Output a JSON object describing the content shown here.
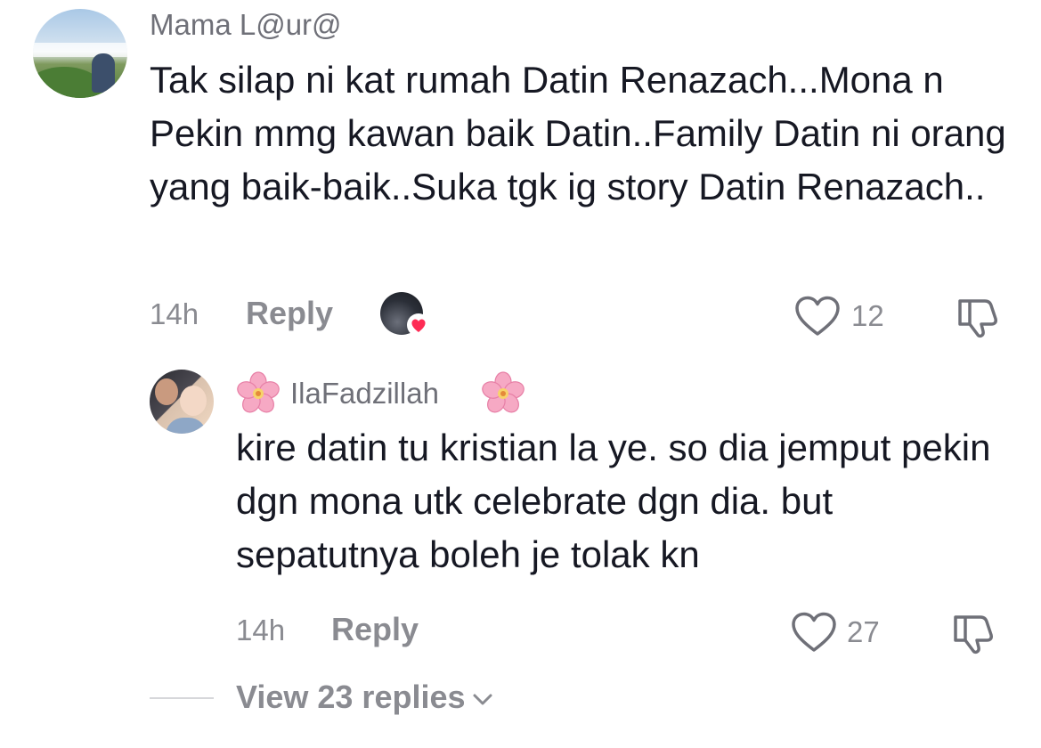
{
  "comments": [
    {
      "username": "Mama L@ur@",
      "text": "Tak silap ni kat rumah Datin Renazach...Mona n Pekin mmg kawan baik Datin..Family Datin ni orang yang baik-baik..Suka tgk ig story Datin Renazach..",
      "time": "14h",
      "reply_label": "Reply",
      "likes": "12",
      "creator_liked": true
    },
    {
      "username": "IlaFadzillah",
      "username_decoration": "cherry-blossom-emoji",
      "text": "kire datin tu kristian la ye. so dia jemput pekin dgn mona utk celebrate dgn dia. but sepatutnya boleh je tolak kn",
      "time": "14h",
      "reply_label": "Reply",
      "likes": "27"
    }
  ],
  "view_replies_label": "View 23 replies",
  "colors": {
    "text_primary": "#161823",
    "text_secondary": "#8a8b91",
    "heart_red": "#fe2c55",
    "flower_pink": "#f6a9c4"
  },
  "icons": {
    "like": "heart-outline-icon",
    "dislike": "thumbs-down-icon",
    "creator_like": "creator-heart-icon",
    "expand": "chevron-down-icon"
  }
}
